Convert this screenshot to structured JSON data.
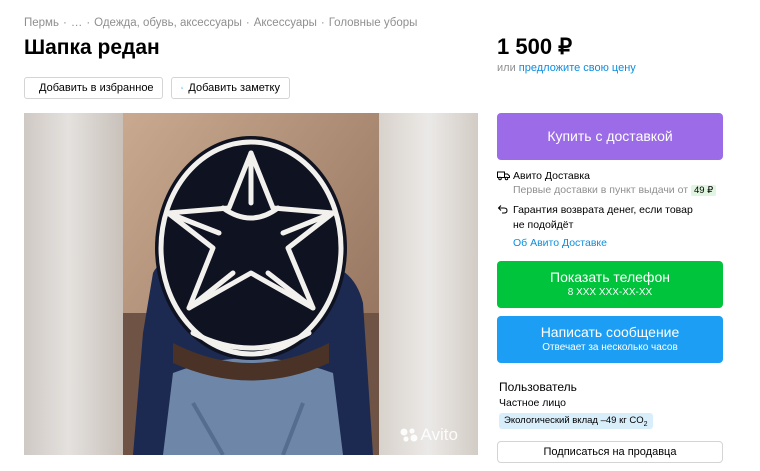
{
  "breadcrumb": [
    "Пермь",
    "…",
    "Одежда, обувь, аксессуары",
    "Аксессуары",
    "Головные уборы"
  ],
  "title": "Шапка редан",
  "actions": {
    "favorite": "Добавить в избранное",
    "note": "Добавить заметку"
  },
  "price": {
    "value": "1 500 ₽",
    "or": "или",
    "offer_link": "предложите свою цену"
  },
  "gallery": {
    "watermark": "Avito"
  },
  "buy_button": "Купить с доставкой",
  "delivery": {
    "title": "Авито Доставка",
    "subtitle": "Первые доставки в пункт выдачи от",
    "price_badge": "49 ₽",
    "guarantee": "Гарантия возврата денег, если товар не подойдёт",
    "about_link": "Об Авито Доставке"
  },
  "phone_button": {
    "label": "Показать телефон",
    "sub": "8 XXX XXX-XX-XX"
  },
  "message_button": {
    "label": "Написать сообщение",
    "sub": "Отвечает за несколько часов"
  },
  "seller": {
    "name": "Пользователь",
    "type": "Частное лицо",
    "eco_badge": "Экологический вклад –49 кг CO",
    "eco_subscript": "2",
    "subscribe": "Подписаться на продавца"
  },
  "colors": {
    "buy": "#9b6be8",
    "phone": "#00c43b",
    "message": "#1b9ef3",
    "link": "#0a8ee0"
  }
}
